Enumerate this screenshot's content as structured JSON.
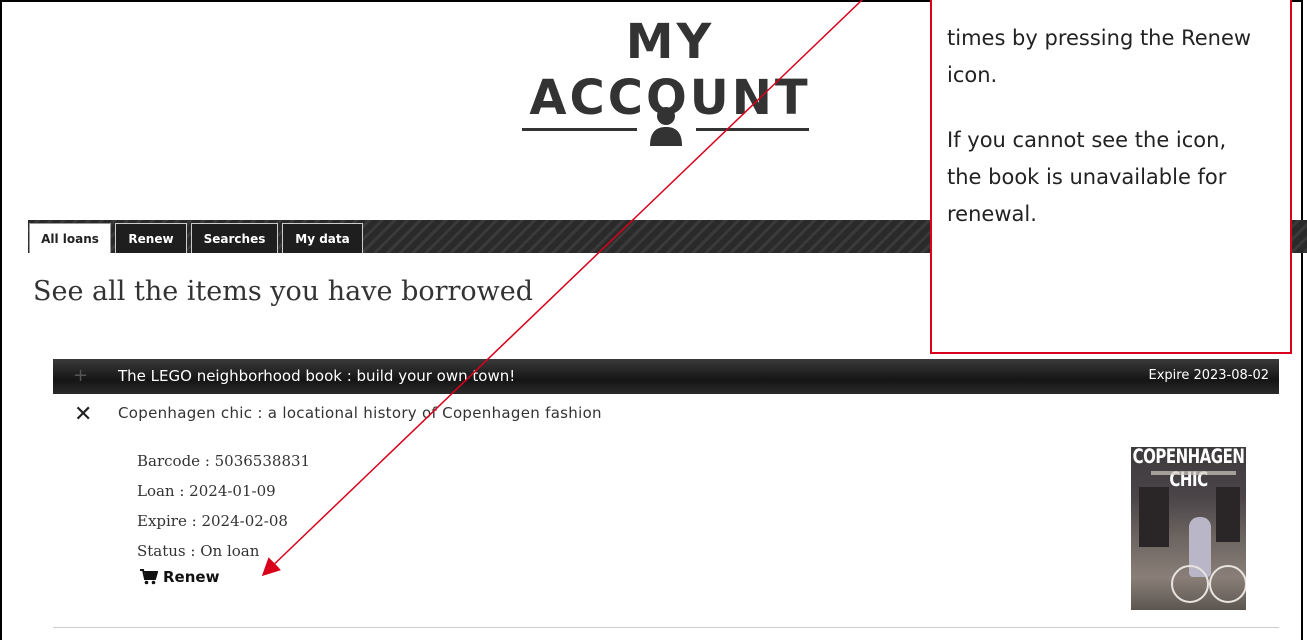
{
  "header": {
    "title": "MY ACCOUNT"
  },
  "tabs": [
    {
      "label": "All loans",
      "active": true
    },
    {
      "label": "Renew",
      "active": false
    },
    {
      "label": "Searches",
      "active": false
    },
    {
      "label": "My data",
      "active": false
    }
  ],
  "main": {
    "heading": "See all the items you have borrowed",
    "loans": [
      {
        "title": "The LEGO neighborhood book : build your own town!",
        "expire": "Expire 2023-08-02",
        "expanded": false
      },
      {
        "title": "Copenhagen chic : a locational history of Copenhagen fashion",
        "expanded": true,
        "barcode": "Barcode : 5036538831",
        "loan": "Loan : 2024-01-09",
        "expire": "Expire : 2024-02-08",
        "status": "Status : On loan",
        "renew_label": "Renew",
        "cover_title": "COPENHAGEN CHIC"
      }
    ]
  },
  "callout": {
    "line1": "times by pressing the Renew icon.",
    "line2": "If you cannot see the icon, the book is unavailable for renewal.",
    "color": "#d9001b"
  },
  "icons": {
    "header": "user-icon",
    "collapsed_row": "plus-icon",
    "expanded_row": "close-icon",
    "renew": "cart-icon"
  }
}
